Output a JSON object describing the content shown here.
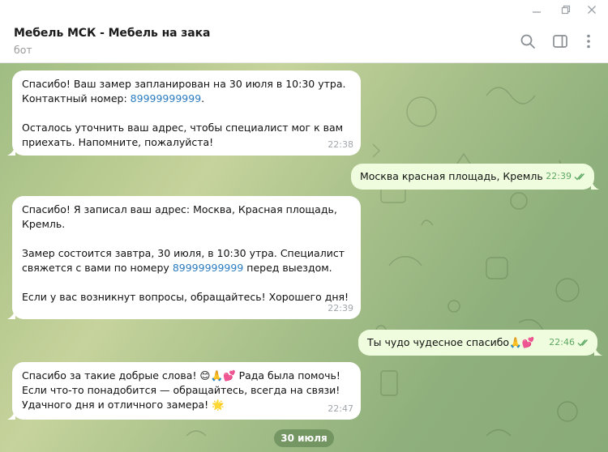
{
  "chat": {
    "title": "Мебель МСК - Мебель на зака",
    "subtitle": "бот"
  },
  "icons": {
    "minimize": "minimize-icon",
    "maximize": "restore-icon",
    "close": "close-icon",
    "search": "search-icon",
    "side_panel": "side-panel-icon",
    "more": "more-vertical-icon",
    "read_receipt": "double-check-icon"
  },
  "colors": {
    "incoming_bubble": "#ffffff",
    "outgoing_bubble": "#effdde",
    "link": "#2b7cbf",
    "read_check": "#5ea865"
  },
  "messages": [
    {
      "direction": "in",
      "p1": "Спасибо! Ваш замер запланирован на 30 июля в 10:30 утра. Контактный номер: ",
      "phone": "89999999999",
      "p2": ".\n\nОсталось уточнить ваш адрес, чтобы специалист мог к вам приехать. Напомните, пожалуйста!",
      "time": "22:38"
    },
    {
      "direction": "out",
      "text": "Москва красная площадь, Кремль",
      "time": "22:39"
    },
    {
      "direction": "in",
      "p1": "Спасибо! Я записал ваш адрес: Москва, Красная площадь, Кремль.\n\nЗамер состоится завтра, 30 июля, в 10:30 утра. Специалист свяжется с вами по номеру ",
      "phone": "89999999999",
      "p2": " перед выездом.\n\nЕсли у вас возникнут вопросы, обращайтесь! Хорошего дня!",
      "time": "22:39"
    },
    {
      "direction": "out",
      "text": "Ты чудо чудесное спасибо🙏💕",
      "time": "22:46"
    },
    {
      "direction": "in",
      "text": "Спасибо за такие добрые слова! 😊🙏💕 Рада была помочь!\nЕсли что-то понадобится — обращайтесь, всегда на связи!\nУдачного дня и отличного замера! 🌟",
      "time": "22:47"
    }
  ],
  "date_separator": "30 июля"
}
